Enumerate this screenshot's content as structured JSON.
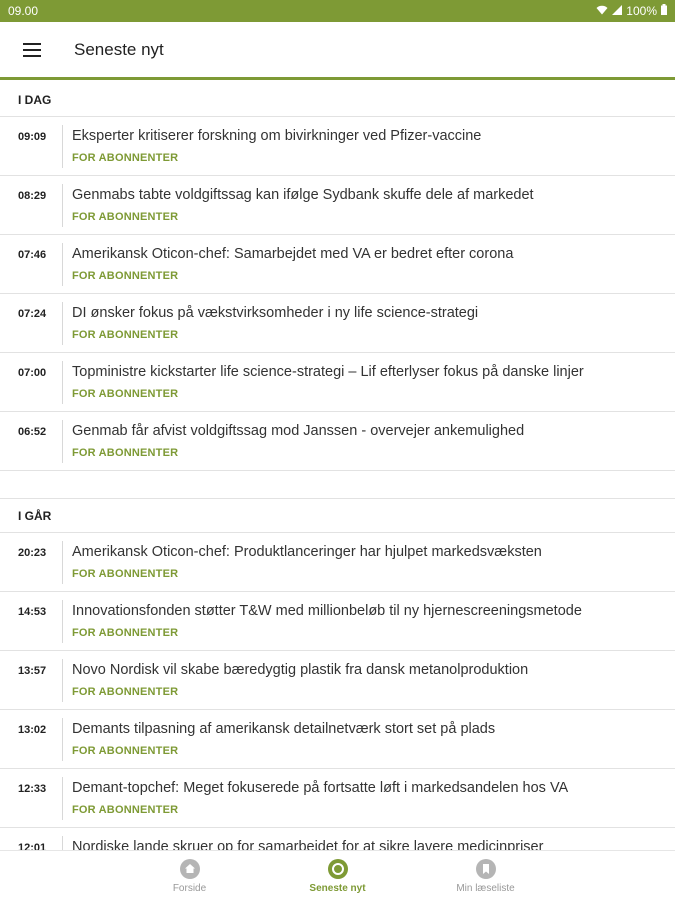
{
  "status_bar": {
    "time": "09.00",
    "battery": "100%"
  },
  "app_bar": {
    "title": "Seneste nyt",
    "menu_icon": "hamburger-menu-icon"
  },
  "colors": {
    "accent": "#7e9a35",
    "divider": "#e2e2e2"
  },
  "sections": [
    {
      "label": "I DAG",
      "items": [
        {
          "time": "09:09",
          "title": "Eksperter kritiserer forskning om bivirkninger ved Pfizer-vaccine",
          "tag": "FOR ABONNENTER"
        },
        {
          "time": "08:29",
          "title": "Genmabs tabte voldgiftssag kan ifølge Sydbank skuffe dele af markedet",
          "tag": "FOR ABONNENTER"
        },
        {
          "time": "07:46",
          "title": "Amerikansk Oticon-chef: Samarbejdet med VA er bedret efter corona",
          "tag": "FOR ABONNENTER"
        },
        {
          "time": "07:24",
          "title": "DI ønsker fokus på vækstvirksomheder i ny life science-strategi",
          "tag": "FOR ABONNENTER"
        },
        {
          "time": "07:00",
          "title": "Topministre kickstarter life science-strategi – Lif efterlyser fokus på danske linjer",
          "tag": "FOR ABONNENTER"
        },
        {
          "time": "06:52",
          "title": "Genmab får afvist voldgiftssag mod Janssen - overvejer ankemulighed",
          "tag": "FOR ABONNENTER"
        }
      ]
    },
    {
      "label": "I GÅR",
      "items": [
        {
          "time": "20:23",
          "title": "Amerikansk Oticon-chef: Produktlanceringer har hjulpet markedsvæksten",
          "tag": "FOR ABONNENTER"
        },
        {
          "time": "14:53",
          "title": "Innovationsfonden støtter T&W med millionbeløb til ny hjernescreeningsmetode",
          "tag": "FOR ABONNENTER"
        },
        {
          "time": "13:57",
          "title": "Novo Nordisk vil skabe bæredygtig plastik fra dansk metanolproduktion",
          "tag": "FOR ABONNENTER"
        },
        {
          "time": "13:02",
          "title": "Demants tilpasning af amerikansk detailnetværk stort set på plads",
          "tag": "FOR ABONNENTER"
        },
        {
          "time": "12:33",
          "title": "Demant-topchef: Meget fokuserede på fortsatte løft i markedsandelen hos VA",
          "tag": "FOR ABONNENTER"
        },
        {
          "time": "12:01",
          "title": "Nordiske lande skruer op for samarbejdet for at sikre lavere medicinpriser",
          "tag": ""
        }
      ]
    }
  ],
  "bottom_nav": [
    {
      "label": "Forside",
      "icon": "home-icon",
      "active": false
    },
    {
      "label": "Seneste nyt",
      "icon": "clock-icon",
      "active": true
    },
    {
      "label": "Min læseliste",
      "icon": "bookmark-icon",
      "active": false
    }
  ]
}
